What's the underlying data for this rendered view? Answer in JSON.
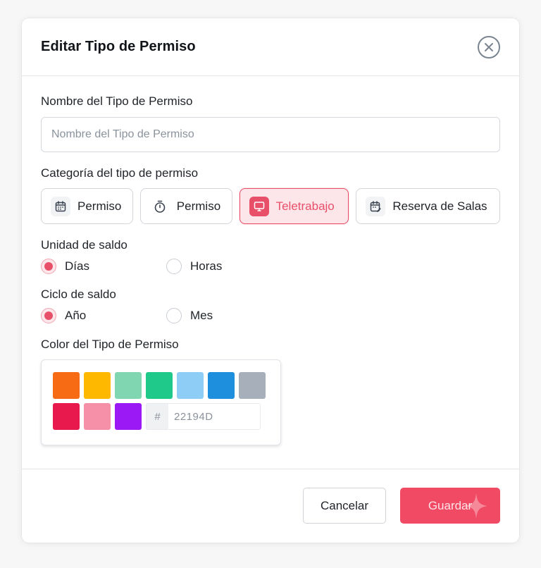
{
  "modal": {
    "title": "Editar Tipo de Permiso"
  },
  "name_field": {
    "label": "Nombre del Tipo de Permiso",
    "value": "",
    "placeholder": "Nombre del Tipo de Permiso"
  },
  "category": {
    "label": "Categoría del tipo de permiso",
    "options": [
      {
        "label": "Permiso",
        "icon": "calendar-icon",
        "selected": false
      },
      {
        "label": "Permiso",
        "icon": "stopwatch-icon",
        "selected": false
      },
      {
        "label": "Teletrabajo",
        "icon": "monitor-icon",
        "selected": true
      },
      {
        "label": "Reserva de Salas",
        "icon": "calendar-edit-icon",
        "selected": false
      }
    ]
  },
  "balance_unit": {
    "label": "Unidad de saldo",
    "options": [
      {
        "label": "Días",
        "checked": true
      },
      {
        "label": "Horas",
        "checked": false
      }
    ]
  },
  "balance_cycle": {
    "label": "Ciclo de saldo",
    "options": [
      {
        "label": "Año",
        "checked": true
      },
      {
        "label": "Mes",
        "checked": false
      }
    ]
  },
  "color": {
    "label": "Color del Tipo de Permiso",
    "swatches_row1": [
      "#f76b15",
      "#ffb800",
      "#7fd6b1",
      "#1ec98a",
      "#8ecdf5",
      "#1e8fdc",
      "#a7b0ba"
    ],
    "swatches_row2": [
      "#e8194d",
      "#f590a8",
      "#9b19f5"
    ],
    "hex_prefix": "#",
    "hex_value": "22194D"
  },
  "footer": {
    "cancel_label": "Cancelar",
    "save_label": "Guardar"
  },
  "colors": {
    "accent": "#e8506a",
    "save_bg": "#f04a64"
  }
}
